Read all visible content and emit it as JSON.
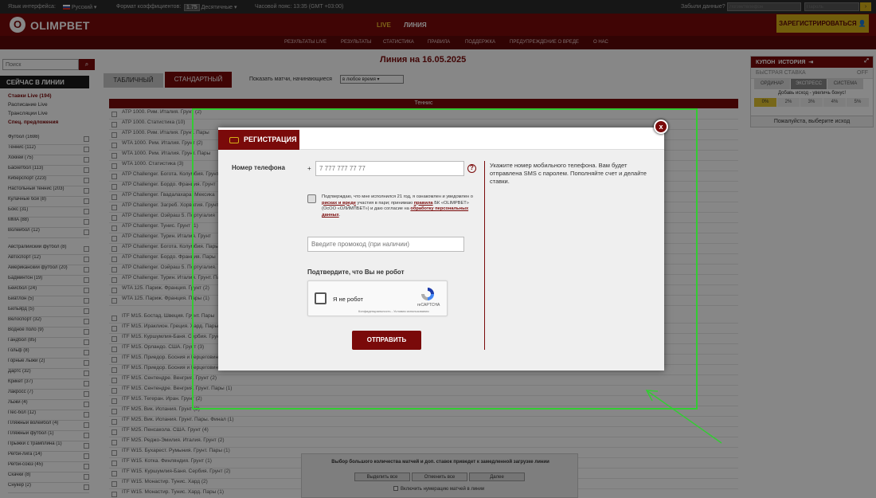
{
  "topbar": {
    "lang_label": "Язык интерфейса:",
    "lang_value": "Русский",
    "coef_label": "Формат коэффициентов:",
    "coef_example": "1.75",
    "coef_value": "Десятичные",
    "tz_label": "Часовой пояс: 13:35 (GMT +03:00)",
    "forgot": "Забыли данные?",
    "login_placeholder": "Логин/телефон",
    "password_placeholder": "Пароль",
    "login_go": "›"
  },
  "header": {
    "logo_icon": "O",
    "logo_text": "OLIMPBET",
    "nav_live": "LIVE",
    "nav_line": "ЛИНИЯ",
    "register_button": "ЗАРЕГИСТРИРОВАТЬСЯ"
  },
  "subnav": [
    "РЕЗУЛЬТАТЫ LIVE",
    "РЕЗУЛЬТАТЫ",
    "СТАТИСТИКА",
    "ПРАВИЛА",
    "ПОДДЕРЖКА",
    "ПРЕДУПРЕЖДЕНИЕ О ВРЕДЕ",
    "О НАС"
  ],
  "left": {
    "search_placeholder": "Поиск",
    "now_header": "СЕЙЧАС В ЛИНИИ",
    "live_links": [
      "Ставки Live (194)",
      "Расписание Live",
      "Трансляции Live",
      "Спец. предложения"
    ],
    "sports": [
      "Футбол (1698)",
      "Теннис (112)",
      "Хоккей (75)",
      "Баскетбол (113)",
      "Киберспорт (223)",
      "Настольный теннис (203)",
      "Кулачные бои (8)",
      "Бокс (31)",
      "MMA (88)",
      "Волейбол (12)",
      "Австралийский футбол (8)",
      "Автоспорт (12)",
      "Американский футбол (20)",
      "Бадминтон (19)",
      "Бейсбол (24)",
      "Биатлон (5)",
      "Бильярд (5)",
      "Велоспорт (32)",
      "Водное поло (9)",
      "Гандбол (85)",
      "Гольф (8)",
      "Горные лыжи (2)",
      "Дартс (32)",
      "Крикет (37)",
      "Лакросс (7)",
      "Лыжи (4)",
      "Пес-бол (12)",
      "Пляжный волейбол (4)",
      "Пляжный футбол (1)",
      "Прыжки с трамплина (1)",
      "Регби-лига (14)",
      "Регби-союз (45)",
      "Скачки (8)",
      "Снукер (2)"
    ]
  },
  "center": {
    "title": "Линия на 16.05.2025",
    "tab_table": "ТАБЛИЧНЫЙ",
    "tab_standard": "СТАНДАРТНЫЙ",
    "show_label": "Показать матчи, начинающиеся",
    "time_select": "в любое время",
    "sport_header": "Теннис",
    "matches_a": [
      "ATP 1000. Рим. Италия. Грунт (2)",
      "ATP 1000. Статистика (10)",
      "ATP 1000. Рим. Италия. Грунт. Пары",
      "WTA 1000. Рим. Италия. Грунт (2)",
      "WTA 1000. Рим. Италия. Грунт. Пары",
      "WTA 1000. Статистика (3)",
      "ATP Challenger. Богота. Колумбия. Грунт",
      "ATP Challenger. Бордо. Франция. Грунт",
      "ATP Challenger. Гвадалахара. Мексика",
      "ATP Challenger. Загреб. Хорватия. Грунт",
      "ATP Challenger. Оэйраш 5. Португалия",
      "ATP Challenger. Тунис. Грунт (1)",
      "ATP Challenger. Турин. Италия. Грунт",
      "ATP Challenger. Богота. Колумбия. Пары",
      "ATP Challenger. Бордо. Франция. Пары",
      "ATP Challenger. Оэйраш 5. Португалия. Пары",
      "ATP Challenger. Турин. Италия. Грунт. Пары",
      "WTA 125. Париж. Франция. Грунт (2)",
      "WTA 125. Париж. Франция. Пары (1)"
    ],
    "matches_b": [
      "ITF M15. Бостад. Швеция. Грунт. Пары",
      "ITF M15. Ираклион. Греция. Хард. Пары",
      "ITF M15. Куршумлия-Баня. Сербия. Грунт",
      "ITF M15. Орландо. США. Грунт (3)",
      "ITF M15. Приедор. Босния и Герцеговина",
      "ITF M15. Приедор. Босния и Герцеговина. Пары",
      "ITF M15. Сентендре. Венгрия. Грунт (2)",
      "ITF M15. Сентендре. Венгрия. Грунт. Пары (1)",
      "ITF M15. Тегеран. Иран. Грунт (2)",
      "ITF M25. Вик. Испания. Грунт (2)",
      "ITF M25. Вик. Испания. Грунт. Пары. Финал (1)",
      "ITF M25. Пенсакола. США. Грунт (4)",
      "ITF M25. Реджо-Эмилия. Италия. Грунт (2)",
      "ITF W15. Бухарест. Румыния. Грунт. Пары (1)",
      "ITF W15. Котка. Финляндия. Грунт (1)",
      "ITF W15. Куршумлия-Баня. Сербия. Грунт (2)",
      "ITF W15. Монастир. Тунис. Хард (2)",
      "ITF W15. Монастир. Тунис. Хард. Пары (1)"
    ]
  },
  "bet_panel": {
    "coupon": "КУПОН",
    "history": "ИСТОРИЯ",
    "fast_bet": "БЫСТРАЯ СТАВКА",
    "fast_state": "OFF",
    "modes": [
      "ОРДИНАР",
      "ЭКСПРЕСС",
      "СИСТЕМА"
    ],
    "bonus_text": "Добавь исход - увеличь бонус!",
    "bonus_steps": [
      "0%",
      "2%",
      "3%",
      "4%",
      "5%"
    ],
    "choose": "Пожалуйста, выберите исход"
  },
  "bottom": {
    "warning": "Выбор большого количества матчей и доп. ставок приведет к замедленной загрузке линии",
    "select_all": "Выделить все",
    "deselect_all": "Отменить все",
    "next": "Далее",
    "numbering": "Включить нумерацию матчей в линии"
  },
  "modal": {
    "title": "РЕГИСТРАЦИЯ",
    "close": "x",
    "phone_label": "Номер телефона",
    "phone_prefix": "+",
    "phone_placeholder": "7 777 777 77 77",
    "help": "?",
    "info": "Укажите номер мобильного телефона. Вам будет отправлена SMS с паролем. Пополняйте счет и делайте ставки.",
    "consent_1": "Подтверждаю, что мне исполнился 21 год, я ознакомлен и уведомлен о",
    "consent_link_1": "рисках и вреде",
    "consent_2": "участия в пари; принимаю",
    "consent_link_2": "правила",
    "consent_3": "БК «OLIMPBET» (ОсОО «ОЛИМПБЕТ») и даю согласие на",
    "consent_link_3": "обработку персональных данных",
    "consent_4": ".",
    "promo_placeholder": "Введите промокод (при наличии)",
    "robot_title": "Подтвердите, что Вы не робот",
    "captcha_label": "Я не робот",
    "captcha_brand": "reCAPTCHA",
    "captcha_privacy": "Конфиденциальность - Условия использования",
    "submit": "ОТПРАВИТЬ"
  },
  "colors": {
    "brand": "#7a0a0a",
    "accent": "#d6b018",
    "highlight": "#33cc33"
  }
}
